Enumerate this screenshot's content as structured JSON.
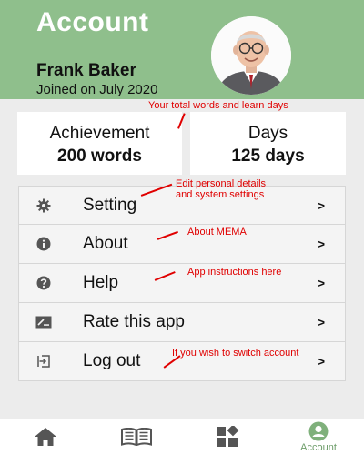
{
  "header": {
    "title": "Account",
    "user_name": "Frank Baker",
    "joined": "Joined on July 2020",
    "background_color": "#8fbf8c"
  },
  "stats": [
    {
      "label": "Achievement",
      "value": "200 words"
    },
    {
      "label": "Days",
      "value": "125 days"
    }
  ],
  "menu": [
    {
      "label": "Setting",
      "icon": "gear-icon",
      "chevron": ">"
    },
    {
      "label": "About",
      "icon": "info-icon",
      "chevron": ">"
    },
    {
      "label": "Help",
      "icon": "help-icon",
      "chevron": ">"
    },
    {
      "label": "Rate this app",
      "icon": "rate-icon",
      "chevron": ">"
    },
    {
      "label": "Log out",
      "icon": "logout-icon",
      "chevron": ">"
    }
  ],
  "annotations": {
    "stats": "Your total words and learn days",
    "setting_line1": "Edit personal details",
    "setting_line2": "and system settings",
    "about": "About MEMA",
    "help": "App instructions here",
    "logout": "If you wish to switch account",
    "color": "#e00000"
  },
  "tabbar": {
    "tabs": [
      {
        "icon": "home-icon",
        "label": ""
      },
      {
        "icon": "book-icon",
        "label": ""
      },
      {
        "icon": "dashboard-icon",
        "label": ""
      },
      {
        "icon": "account-icon",
        "label": "Account",
        "active": true
      }
    ],
    "active_color": "#6e9d6a"
  }
}
